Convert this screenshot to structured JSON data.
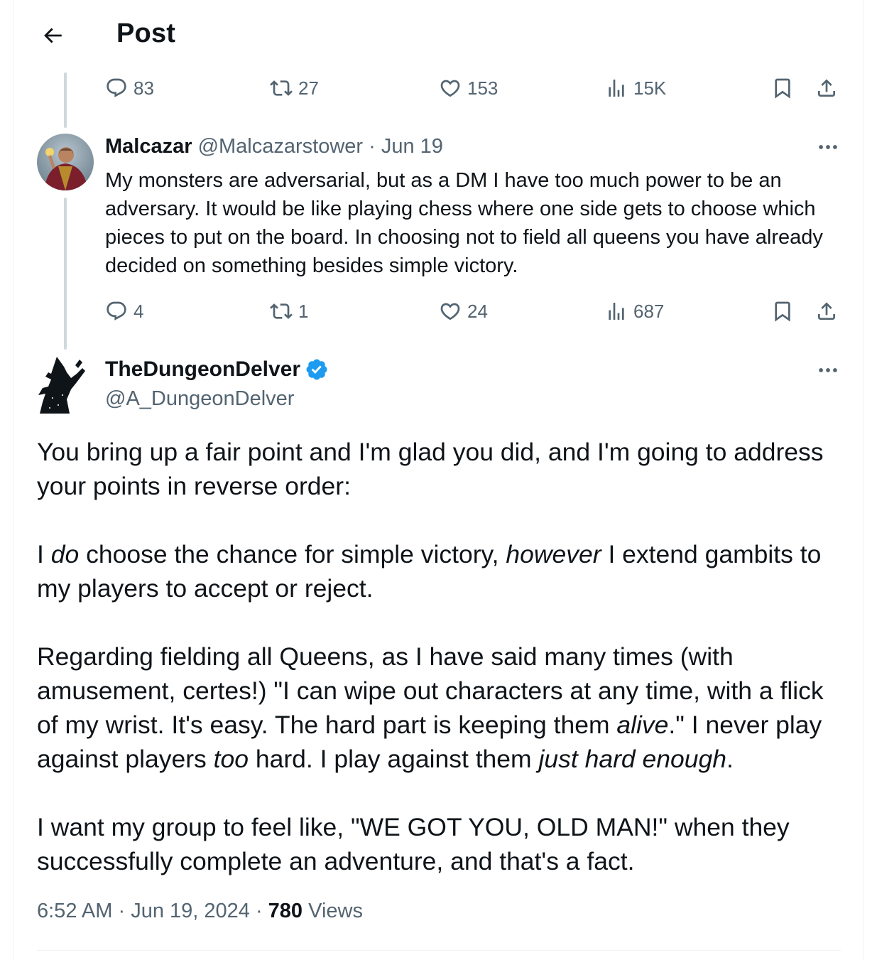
{
  "header": {
    "title": "Post",
    "back_icon": "arrow-left-icon"
  },
  "parent_actions": {
    "replies": "83",
    "reposts": "27",
    "likes": "153",
    "views": "15K"
  },
  "reply": {
    "name": "Malcazar",
    "handle": "@Malcazarstower",
    "separator": " · ",
    "date": "Jun 19",
    "text": "My monsters are adversarial, but as a DM I have too much power to be an adversary. It would be like playing chess where one side gets to choose which pieces to put on the board. In choosing not to field all queens you have already decided on something besides simple victory.",
    "actions": {
      "replies": "4",
      "reposts": "1",
      "likes": "24",
      "views": "687"
    }
  },
  "post": {
    "name": "TheDungeonDelver",
    "handle": "@A_DungeonDelver",
    "verified": true,
    "paragraphs": {
      "p1": "You bring up a fair point and I'm glad you did, and I'm going to address your points in reverse order:",
      "p2": {
        "a": "I ",
        "b": "do",
        "c": " choose the chance for simple victory, ",
        "d": "however",
        "e": " I extend gambits to my players to accept or reject."
      },
      "p3": {
        "a": "Regarding fielding all Queens, as I have said many times (with amusement, certes!) \"I can wipe out characters at any time, with a flick of my wrist. It's easy. The hard part is keeping them ",
        "b": "alive",
        "c": ".\"  I never play against players ",
        "d": "too",
        "e": " hard. I play against them ",
        "f": "just hard enough",
        "g": "."
      },
      "p4": "I want my group to feel like, \"WE GOT YOU, OLD MAN!\" when they successfully complete an adventure, and that's a fact."
    },
    "time": "6:52 AM",
    "sep1": " · ",
    "date": "Jun 19, 2024",
    "sep2": " · ",
    "views_count": "780",
    "views_label": " Views"
  },
  "colors": {
    "text": "#0f1419",
    "muted": "#536471",
    "verified": "#1d9bf0",
    "thread": "#cfd9de"
  }
}
